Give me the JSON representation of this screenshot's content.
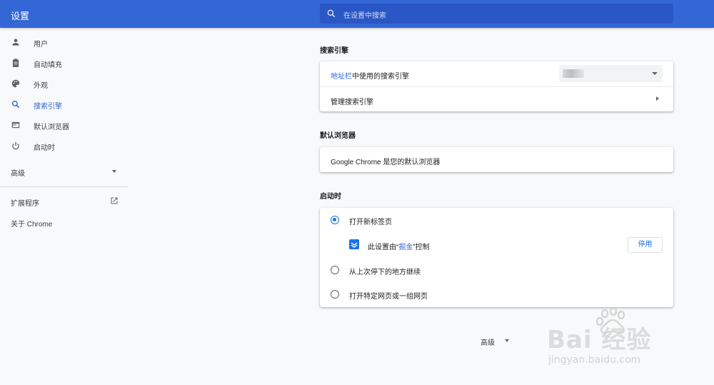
{
  "header": {
    "title": "设置",
    "search_placeholder": "在设置中搜索"
  },
  "sidebar": {
    "items": [
      {
        "label": "用户",
        "icon": "person-icon"
      },
      {
        "label": "自动填充",
        "icon": "clipboard-icon"
      },
      {
        "label": "外观",
        "icon": "palette-icon"
      },
      {
        "label": "搜索引擎",
        "icon": "search-icon",
        "active": true
      },
      {
        "label": "默认浏览器",
        "icon": "browser-icon"
      },
      {
        "label": "启动时",
        "icon": "power-icon"
      }
    ],
    "advanced": "高级",
    "extensions": "扩展程序",
    "about": "关于 Chrome"
  },
  "search_engine": {
    "title": "搜索引擎",
    "row1_link": "地址栏",
    "row1_rest": "中使用的搜索引擎",
    "row2": "管理搜索引擎"
  },
  "default_browser": {
    "title": "默认浏览器",
    "text": "Google Chrome 是您的默认浏览器"
  },
  "startup": {
    "title": "启动时",
    "options": [
      "打开新标签页",
      "从上次停下的地方继续",
      "打开特定网页或一组网页"
    ],
    "selected": 0,
    "controlled_pre": "此设置由“",
    "controlled_ext": "掘金",
    "controlled_post": "”控制",
    "disable_button": "停用"
  },
  "footer": {
    "advanced": "高级"
  },
  "watermark": {
    "main": "Bai 经验",
    "sub": "jingyan.baidu.com"
  },
  "colors": {
    "header": "#3367d6",
    "accent": "#1a73e8",
    "background": "#f8f9fa"
  }
}
